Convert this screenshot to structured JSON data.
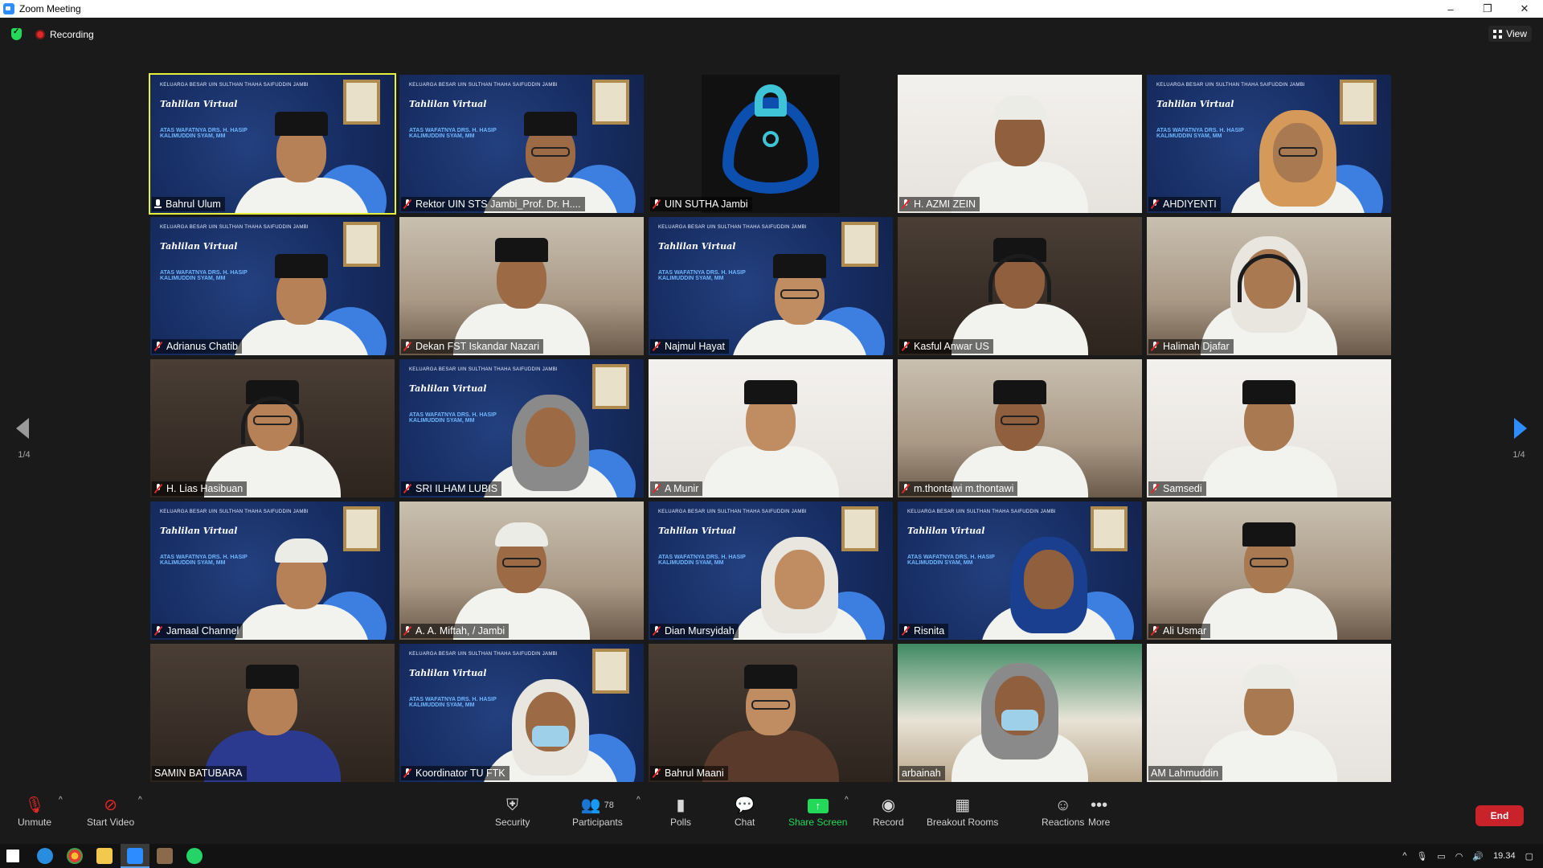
{
  "window": {
    "title": "Zoom Meeting",
    "controls": [
      "–",
      "❐",
      "✕"
    ]
  },
  "topbar": {
    "recording_label": "Recording",
    "view_label": "View"
  },
  "pagination": {
    "left": "1/4",
    "right": "1/4"
  },
  "participants": [
    {
      "name": "Bahrul Ulum",
      "scene": "banner",
      "muted": false,
      "active": true
    },
    {
      "name": "Rektor UIN STS Jambi_Prof. Dr. H....",
      "scene": "banner",
      "muted": true
    },
    {
      "name": "UIN SUTHA Jambi",
      "scene": "logo",
      "muted": true
    },
    {
      "name": "H. AZMI ZEIN",
      "scene": "white",
      "muted": true
    },
    {
      "name": "AHDIYENTI",
      "scene": "banner",
      "muted": true
    },
    {
      "name": "Adrianus Chatib",
      "scene": "banner",
      "muted": true
    },
    {
      "name": "Dekan FST Iskandar Nazari",
      "scene": "room",
      "muted": true
    },
    {
      "name": "Najmul Hayat",
      "scene": "banner",
      "muted": true
    },
    {
      "name": "Kasful Anwar US",
      "scene": "dark",
      "muted": true
    },
    {
      "name": "Halimah Djafar",
      "scene": "room",
      "muted": true
    },
    {
      "name": "H. Lias Hasibuan",
      "scene": "dark",
      "muted": true
    },
    {
      "name": "SRI ILHAM LUBIS",
      "scene": "banner",
      "muted": true
    },
    {
      "name": "A Munir",
      "scene": "white",
      "muted": true
    },
    {
      "name": "m.thontawi m.thontawi",
      "scene": "room",
      "muted": true
    },
    {
      "name": "Samsedi",
      "scene": "white",
      "muted": true
    },
    {
      "name": "Jamaal Channel",
      "scene": "banner",
      "muted": true
    },
    {
      "name": "A. A. Miftah, / Jambi",
      "scene": "room",
      "muted": true
    },
    {
      "name": "Dian Mursyidah",
      "scene": "banner",
      "muted": true
    },
    {
      "name": "Risnita",
      "scene": "banner",
      "muted": true
    },
    {
      "name": "Ali Usmar",
      "scene": "room",
      "muted": true
    },
    {
      "name": "SAMIN BATUBARA",
      "scene": "dark",
      "muted": false
    },
    {
      "name": "Koordinator TU FTK",
      "scene": "banner",
      "muted": true
    },
    {
      "name": "Bahrul Maani",
      "scene": "dark",
      "muted": true
    },
    {
      "name": "arbainah",
      "scene": "green",
      "muted": false
    },
    {
      "name": "AM Lahmuddin",
      "scene": "white",
      "muted": false
    }
  ],
  "banner": {
    "top_line": "KELUARGA BESAR UIN SULTHAN THAHA SAIFUDDIN JAMBI",
    "headline": "Tahlilan Virtual",
    "sub": "ATAS WAFATNYA DRS. H. HASIP KALIMUDDIN SYAM, MM"
  },
  "toolbar": {
    "unmute": "Unmute",
    "start_video": "Start Video",
    "security": "Security",
    "participants": "Participants",
    "participant_count": "78",
    "polls": "Polls",
    "chat": "Chat",
    "share_screen": "Share Screen",
    "record": "Record",
    "breakout_rooms": "Breakout Rooms",
    "reactions": "Reactions",
    "more": "More",
    "end": "End"
  },
  "taskbar": {
    "time": "19.34"
  },
  "colors": {
    "accent": "#2d8cff",
    "share": "#23d959",
    "end": "#c9222a",
    "active_speaker": "#e6f03a"
  }
}
